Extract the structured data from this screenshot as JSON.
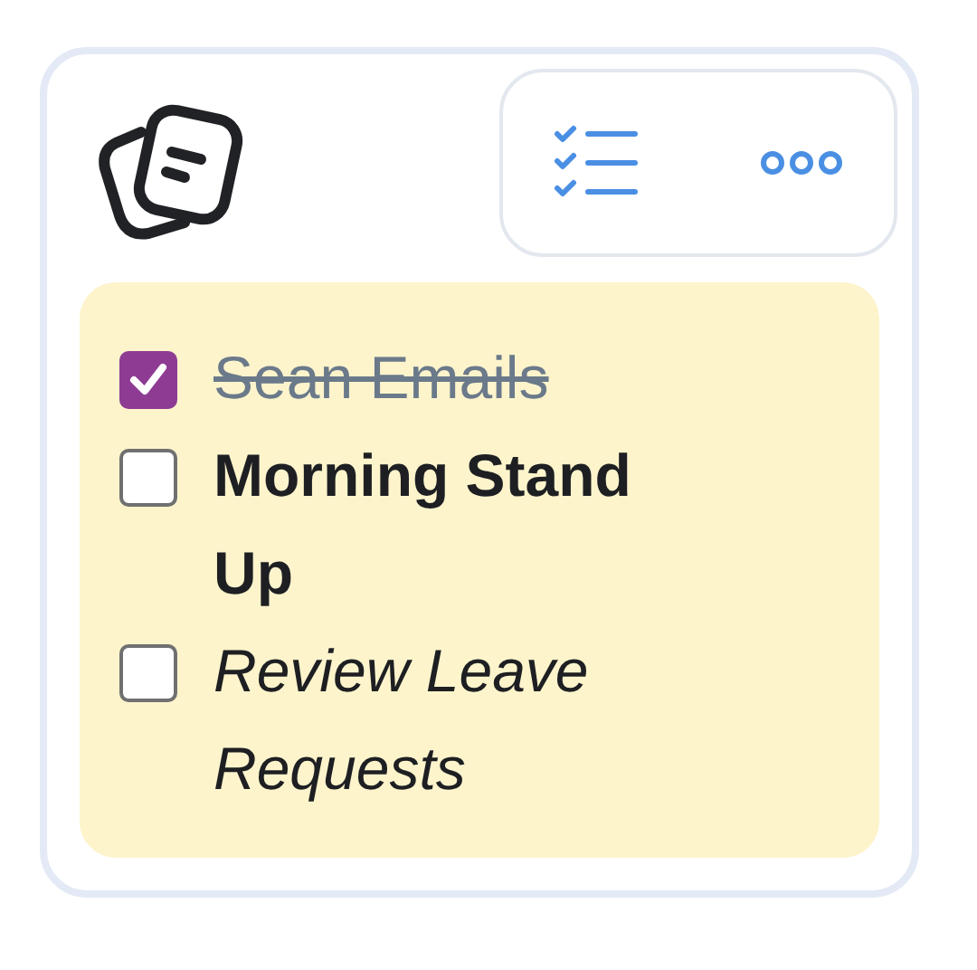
{
  "toolbar": {
    "buttons": [
      {
        "kind": "checklist"
      },
      {
        "kind": "more"
      }
    ]
  },
  "note": {
    "color": "#fdf4cc",
    "items": [
      {
        "text": "Sean Emails",
        "checked": true,
        "kind": "strike"
      },
      {
        "text": "Morning Stand Up",
        "checked": false,
        "kind": "bold"
      },
      {
        "text": "Review Leave Requests",
        "checked": false,
        "kind": "italic"
      }
    ]
  }
}
